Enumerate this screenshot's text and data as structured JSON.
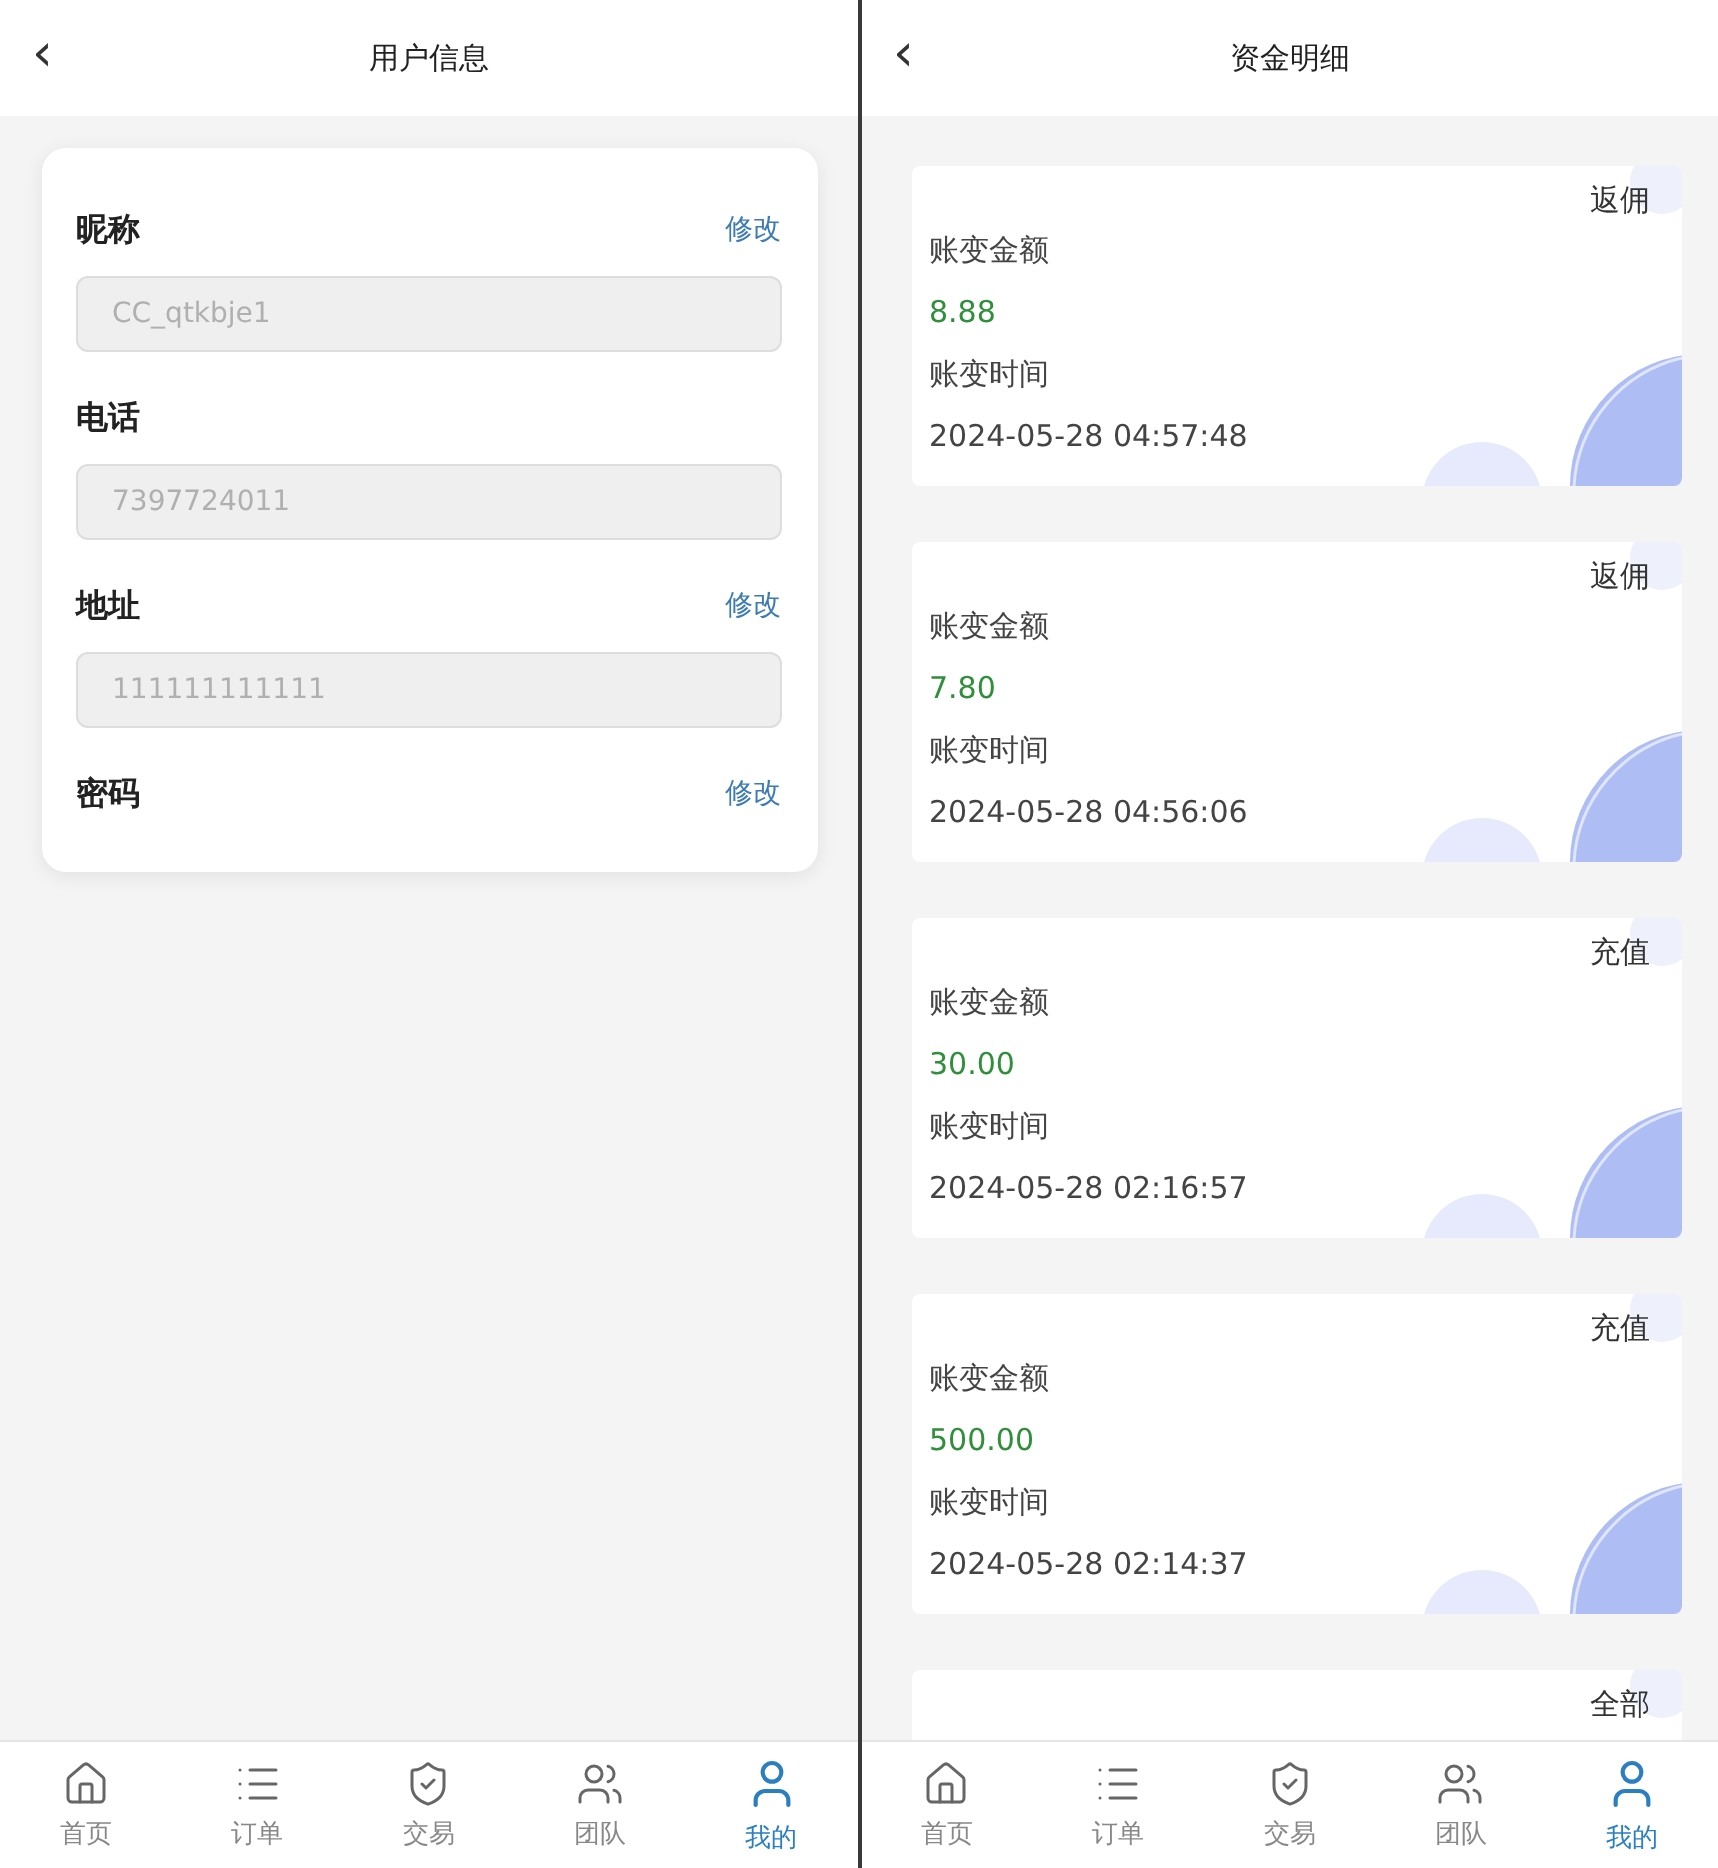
{
  "screens": [
    {
      "kind": "profile",
      "back_icon": "‹",
      "title": "用户信息",
      "fields": [
        {
          "label": "昵称",
          "edit_link": "修改",
          "value": "CC_qtkbje1"
        },
        {
          "label": "电话",
          "value": "7397724011"
        },
        {
          "label": "地址",
          "edit_link": "修改",
          "value": "111111111111"
        },
        {
          "label": "密码",
          "edit_link": "修改"
        }
      ],
      "nav": [
        {
          "label": "首页",
          "selected": false
        },
        {
          "label": "订单",
          "selected": false
        },
        {
          "label": "交易",
          "selected": false
        },
        {
          "label": "团队",
          "selected": false
        },
        {
          "label": "我的",
          "selected": true
        }
      ]
    },
    {
      "kind": "ledger",
      "back_icon": "‹",
      "title": "资金明细",
      "records": [
        {
          "type": "返佣",
          "amount_label": "账变金额",
          "amount": "8.88",
          "time_label": "账变时间",
          "time": "2024-05-28 04:57:48"
        },
        {
          "type": "返佣",
          "amount_label": "账变金额",
          "amount": "7.80",
          "time_label": "账变时间",
          "time": "2024-05-28 04:56:06"
        },
        {
          "type": "充值",
          "amount_label": "账变金额",
          "amount": "30.00",
          "time_label": "账变时间",
          "time": "2024-05-28 02:16:57"
        },
        {
          "type": "充值",
          "amount_label": "账变金额",
          "amount": "500.00",
          "time_label": "账变时间",
          "time": "2024-05-28 02:14:37"
        },
        {
          "type": "全部"
        }
      ],
      "nav": [
        {
          "label": "首页",
          "selected": false
        },
        {
          "label": "订单",
          "selected": false
        },
        {
          "label": "交易",
          "selected": false
        },
        {
          "label": "团队",
          "selected": false
        },
        {
          "label": "我的",
          "selected": true
        }
      ]
    }
  ]
}
